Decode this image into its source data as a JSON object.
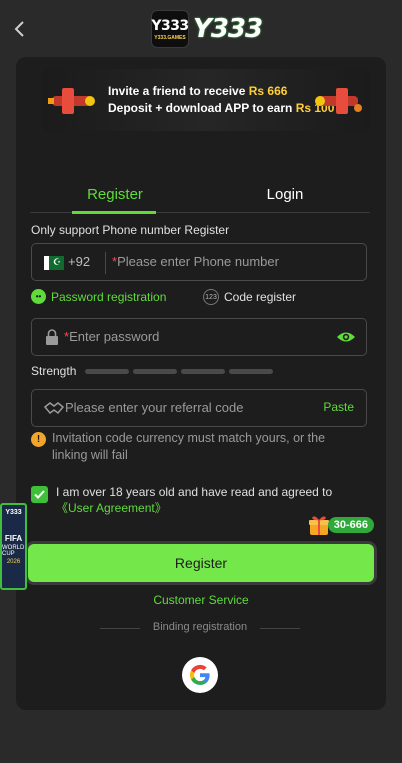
{
  "header": {
    "logo_badge_big": "Y333",
    "logo_badge_small": "Y333.GAMES",
    "logo_text": "Y333"
  },
  "banner": {
    "line1_prefix": "Invite a friend to receive ",
    "line1_amount": "Rs 666",
    "line2_prefix": "Deposit + download APP to earn ",
    "line2_amount": "Rs 100"
  },
  "tabs": [
    {
      "label": "Register",
      "active": true
    },
    {
      "label": "Login",
      "active": false
    }
  ],
  "form": {
    "support_text": "Only support Phone number Register",
    "country_code": "+92",
    "phone_placeholder": "Please enter Phone number",
    "option_password": "Password registration",
    "option_code": "Code register",
    "password_placeholder": "Enter password",
    "strength_label": "Strength",
    "referral_placeholder": "Please enter your referral code",
    "paste_label": "Paste",
    "warning": "Invitation code currency must match yours, or the linking will fail",
    "agree_text": "I am over 18 years old and have read and agreed to ",
    "agree_link": "《User Agreement》",
    "register_button": "Register",
    "gift_badge": "30-666",
    "customer_service": "Customer Service",
    "binding": "Binding registration"
  },
  "side_promo": {
    "badge": "Y333",
    "title": "FIFA",
    "sub": "WORLD CUP",
    "year": "2026"
  },
  "colors": {
    "accent": "#5fdc3a",
    "button": "#74e84a",
    "background": "#2a2a2a",
    "card": "#1d1d1d",
    "warning": "#f1a62b",
    "required": "#ff4b4b"
  },
  "icons": [
    "back-arrow-icon",
    "pakistan-flag-icon",
    "lock-icon",
    "eye-icon",
    "handshake-icon",
    "warning-icon",
    "checkbox-icon",
    "gift-icon",
    "google-icon"
  ]
}
